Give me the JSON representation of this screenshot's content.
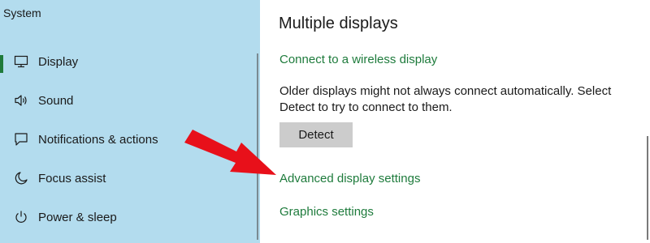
{
  "sidebar": {
    "title": "System",
    "items": [
      {
        "label": "Display",
        "icon": "monitor-icon",
        "selected": true
      },
      {
        "label": "Sound",
        "icon": "speaker-icon",
        "selected": false
      },
      {
        "label": "Notifications & actions",
        "icon": "notification-icon",
        "selected": false
      },
      {
        "label": "Focus assist",
        "icon": "moon-icon",
        "selected": false
      },
      {
        "label": "Power & sleep",
        "icon": "power-icon",
        "selected": false
      }
    ]
  },
  "main": {
    "heading": "Multiple displays",
    "wireless_link": "Connect to a wireless display",
    "description": "Older displays might not always connect automatically. Select Detect to try to connect to them.",
    "detect_button": "Detect",
    "advanced_link": "Advanced display settings",
    "graphics_link": "Graphics settings"
  },
  "colors": {
    "sidebar_bg": "#b3dcee",
    "link": "#1e7b3c",
    "accent": "#1f7a3a",
    "arrow": "#e8101a",
    "button_bg": "#cccccc"
  }
}
